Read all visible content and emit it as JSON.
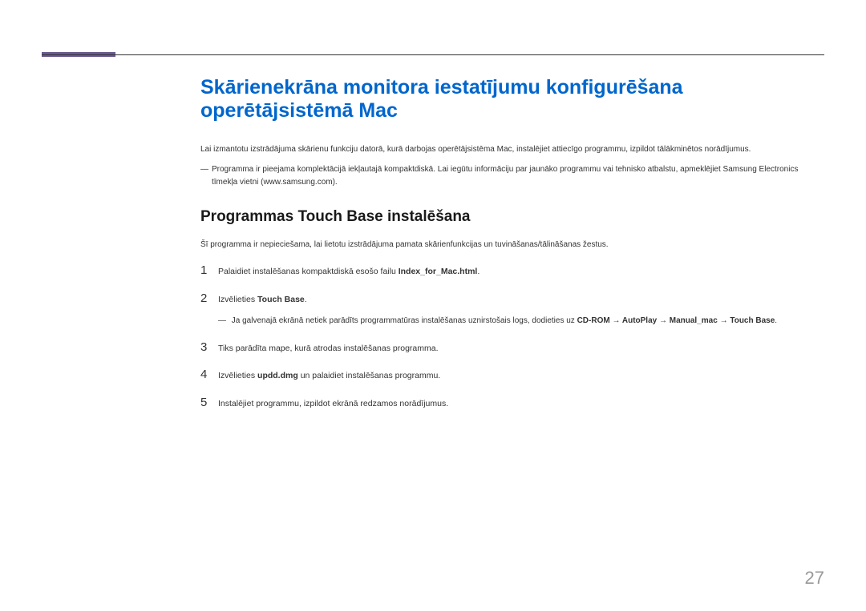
{
  "heading": "Skārienekrāna monitora iestatījumu konfigurēšana operētājsistēmā Mac",
  "intro": "Lai izmantotu izstrādājuma skārienu funkciju datorā, kurā darbojas operētājsistēma Mac, instalējiet attiecīgo programmu, izpildot tālākminētos norādījumus.",
  "note": "Programma ir pieejama komplektācijā iekļautajā kompaktdiskā. Lai iegūtu informāciju par jaunāko programmu vai tehnisko atbalstu, apmeklējiet Samsung Electronics tīmekļa vietni (www.samsung.com).",
  "section_title": "Programmas Touch Base instalēšana",
  "section_desc": "Šī programma ir nepieciešama, lai lietotu izstrādājuma pamata skārienfunkcijas un tuvināšanas/tālināšanas žestus.",
  "steps": [
    {
      "num": "1",
      "prefix": "Palaidiet instalēšanas kompaktdiskā esošo failu ",
      "bold": "Index_for_Mac.html",
      "suffix": "."
    },
    {
      "num": "2",
      "prefix": "Izvēlieties ",
      "bold": "Touch Base",
      "suffix": ".",
      "subnote_prefix": "Ja galvenajā ekrānā netiek parādīts programmatūras instalēšanas uznirstošais logs, dodieties uz ",
      "subnote_bold": "CD-ROM → AutoPlay → Manual_mac → Touch Base",
      "subnote_suffix": "."
    },
    {
      "num": "3",
      "prefix": "Tiks parādīta mape, kurā atrodas instalēšanas programma.",
      "bold": "",
      "suffix": ""
    },
    {
      "num": "4",
      "prefix": "Izvēlieties ",
      "bold": "updd.dmg",
      "suffix": " un palaidiet instalēšanas programmu."
    },
    {
      "num": "5",
      "prefix": "Instalējiet programmu, izpildot ekrānā redzamos norādījumus.",
      "bold": "",
      "suffix": ""
    }
  ],
  "page_number": "27"
}
